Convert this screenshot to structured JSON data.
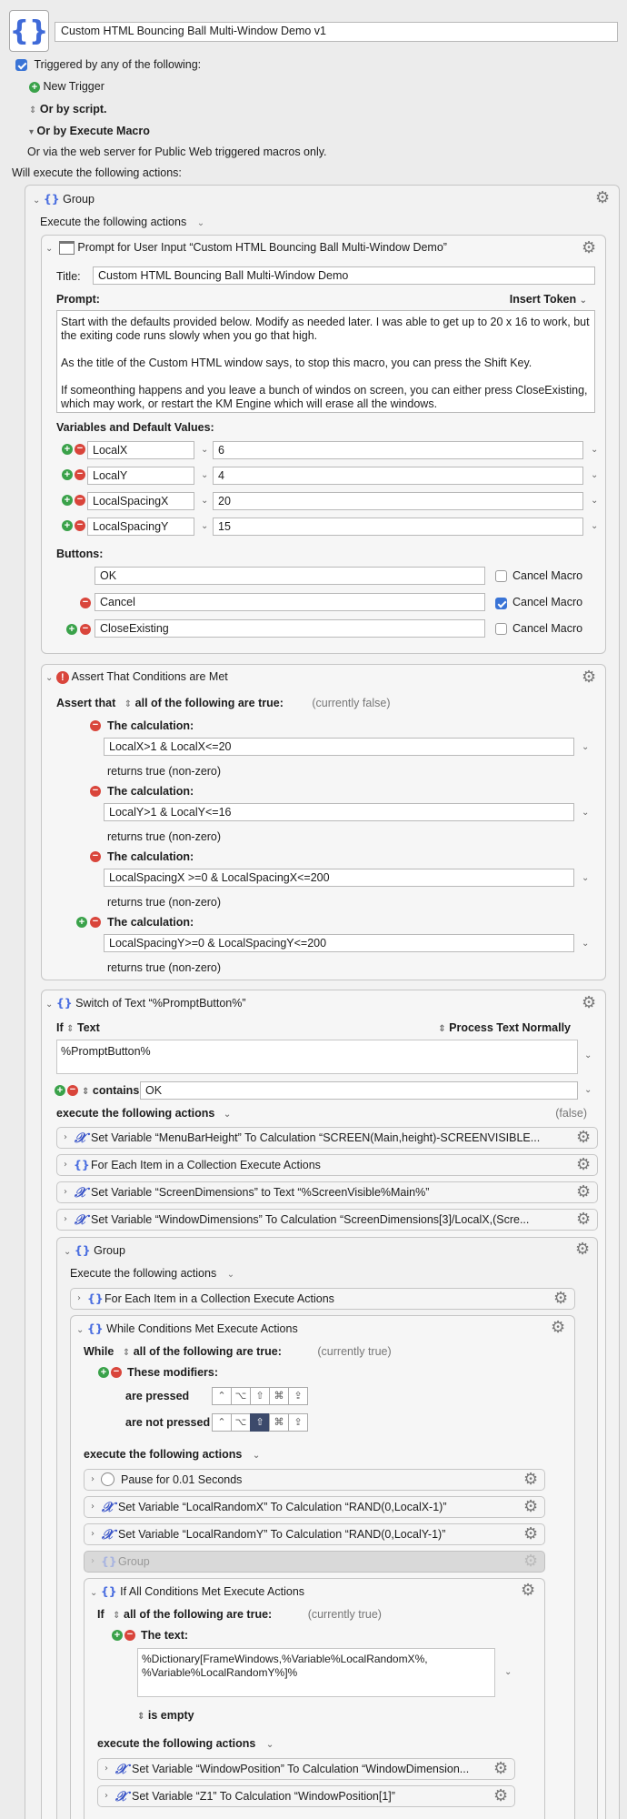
{
  "macro": {
    "title": "Custom HTML Bouncing Ball Multi-Window Demo v1"
  },
  "triggers": {
    "triggered_label": "Triggered by any of the following:",
    "new_trigger": "New Trigger",
    "by_script": "Or by script.",
    "by_execute": "Or by Execute Macro",
    "web": "Or via the web server for Public Web triggered macros only."
  },
  "will_execute": "Will execute the following actions:",
  "group1": {
    "title": "Group",
    "exec_label": "Execute the following actions"
  },
  "prompt": {
    "header": "Prompt for User Input “Custom HTML Bouncing Ball Multi-Window Demo”",
    "title_label": "Title:",
    "title_value": "Custom HTML Bouncing Ball Multi-Window Demo",
    "prompt_label": "Prompt:",
    "insert_token": "Insert Token",
    "prompt_line1": "Start with the defaults provided below. Modify as needed later. I was able to get up to 20 x 16 to work, but the exiting code runs slowly when you go that high.",
    "prompt_line2": "As the title of the Custom HTML window says, to stop this macro, you can press the Shift Key.",
    "prompt_line3": "If someonthing happens and you leave a bunch of windos on screen, you can either press CloseExisting, which may work, or restart the KM Engine which will erase all the windows.",
    "vars_label": "Variables and Default Values:",
    "vars": [
      {
        "name": "LocalX",
        "value": "6"
      },
      {
        "name": "LocalY",
        "value": "4"
      },
      {
        "name": "LocalSpacingX",
        "value": "20"
      },
      {
        "name": "LocalSpacingY",
        "value": "15"
      }
    ],
    "buttons_label": "Buttons:",
    "buttons": [
      {
        "name": "OK",
        "cancel": "Cancel Macro",
        "checked": false
      },
      {
        "name": "Cancel",
        "cancel": "Cancel Macro",
        "checked": true
      },
      {
        "name": "CloseExisting",
        "cancel": "Cancel Macro",
        "checked": false
      }
    ]
  },
  "assert": {
    "header": "Assert That Conditions are Met",
    "assert_that": "Assert that",
    "all_following": "all of the following are true:",
    "status": "(currently false)",
    "calc_label": "The calculation:",
    "returns": "returns true (non-zero)",
    "conditions": [
      "LocalX>1 & LocalX<=20",
      "LocalY>1 & LocalY<=16",
      "LocalSpacingX >=0 & LocalSpacingX<=200",
      "LocalSpacingY>=0 & LocalSpacingY<=200"
    ]
  },
  "switch": {
    "header": "Switch of Text “%PromptButton%”",
    "if": "If",
    "text": "Text",
    "process": "Process Text Normally",
    "value": "%PromptButton%",
    "contains": "contains",
    "contains_value": "OK",
    "exec_label": "execute the following actions",
    "false": "(false)",
    "actions": [
      "Set Variable “MenuBarHeight” To Calculation “SCREEN(Main,height)-SCREENVISIBLE...",
      "For Each Item in a Collection Execute Actions",
      "Set Variable “ScreenDimensions” to Text “%ScreenVisible%Main%”",
      "Set Variable “WindowDimensions” To Calculation “ScreenDimensions[3]/LocalX,(Scre..."
    ]
  },
  "group2": {
    "title": "Group",
    "exec_label": "Execute the following actions",
    "for_each": "For Each Item in a Collection Execute Actions"
  },
  "while": {
    "header": "While Conditions Met Execute Actions",
    "while": "While",
    "all_following": "all of the following are true:",
    "status": "(currently true)",
    "modifiers": "These modifiers:",
    "are_pressed": "are pressed",
    "not_pressed": "are not pressed",
    "keys": [
      "⌃",
      "⌥",
      "⇧",
      "⌘",
      "⇪"
    ],
    "exec_label": "execute the following actions",
    "actions": [
      "Pause for 0.01 Seconds",
      "Set Variable “LocalRandomX” To Calculation “RAND(0,LocalX-1)”",
      "Set Variable “LocalRandomY” To Calculation “RAND(0,LocalY-1)”",
      "Group"
    ]
  },
  "ifall": {
    "header": "If All Conditions Met Execute Actions",
    "if": "If",
    "all_following": "all of the following are true:",
    "status": "(currently true)",
    "the_text": "The text:",
    "text_line1": "%Dictionary[FrameWindows,%Variable%LocalRandomX%,",
    "text_line2": "%Variable%LocalRandomY%]%",
    "is_empty": "is empty",
    "exec_label": "execute the following actions",
    "actions": [
      "Set Variable “WindowPosition” To Calculation “WindowDimension...",
      "Set Variable “Z1” To Calculation “WindowPosition[1]”"
    ]
  }
}
